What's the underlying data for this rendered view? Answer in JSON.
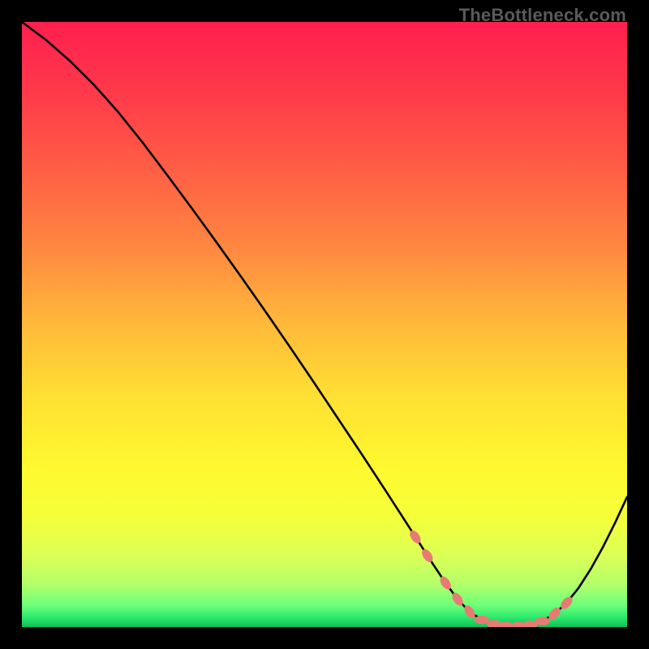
{
  "watermark": "TheBottleneck.com",
  "colors": {
    "background": "#000000",
    "curve": "#000000",
    "marker_fill": "#e77b74",
    "marker_stroke": "#e77b74",
    "gradient_stops": [
      {
        "offset": 0.0,
        "color": "#ff1f4f"
      },
      {
        "offset": 0.12,
        "color": "#ff3a4a"
      },
      {
        "offset": 0.25,
        "color": "#ff6044"
      },
      {
        "offset": 0.38,
        "color": "#ff8a40"
      },
      {
        "offset": 0.5,
        "color": "#ffb93a"
      },
      {
        "offset": 0.62,
        "color": "#ffe033"
      },
      {
        "offset": 0.74,
        "color": "#fff92f"
      },
      {
        "offset": 0.82,
        "color": "#f4ff3a"
      },
      {
        "offset": 0.88,
        "color": "#ddff55"
      },
      {
        "offset": 0.93,
        "color": "#b2ff6a"
      },
      {
        "offset": 0.965,
        "color": "#6bff7a"
      },
      {
        "offset": 0.985,
        "color": "#28e86b"
      },
      {
        "offset": 1.0,
        "color": "#0fbf56"
      }
    ]
  },
  "chart_data": {
    "type": "line",
    "title": "",
    "xlabel": "",
    "ylabel": "",
    "xlim": [
      0,
      100
    ],
    "ylim": [
      0,
      100
    ],
    "series": [
      {
        "name": "bottleneck-curve",
        "x": [
          0,
          4,
          8,
          12,
          16,
          20,
          24,
          28,
          32,
          36,
          40,
          44,
          48,
          52,
          56,
          60,
          62,
          64,
          66,
          68,
          70,
          72,
          74,
          76,
          78,
          80,
          82,
          84,
          86,
          88,
          90,
          92,
          94,
          96,
          98,
          100
        ],
        "y": [
          100,
          97,
          93.5,
          89.5,
          85,
          80,
          74.7,
          69.3,
          63.8,
          58.2,
          52.5,
          46.7,
          40.8,
          34.8,
          28.8,
          22.7,
          19.6,
          16.5,
          13.4,
          10.3,
          7.3,
          4.6,
          2.5,
          1.2,
          0.5,
          0.2,
          0.2,
          0.4,
          1.0,
          2.2,
          4.0,
          6.5,
          9.6,
          13.2,
          17.2,
          21.5
        ]
      }
    ],
    "markers": {
      "name": "highlighted-points",
      "points": [
        {
          "x": 65,
          "y": 14.9
        },
        {
          "x": 67,
          "y": 11.8
        },
        {
          "x": 70,
          "y": 7.3
        },
        {
          "x": 72,
          "y": 4.6
        },
        {
          "x": 74,
          "y": 2.5
        },
        {
          "x": 76,
          "y": 1.2
        },
        {
          "x": 78,
          "y": 0.5
        },
        {
          "x": 80,
          "y": 0.2
        },
        {
          "x": 82,
          "y": 0.2
        },
        {
          "x": 84,
          "y": 0.4
        },
        {
          "x": 86,
          "y": 1.0
        },
        {
          "x": 88,
          "y": 2.2
        },
        {
          "x": 90,
          "y": 4.0
        }
      ]
    }
  }
}
